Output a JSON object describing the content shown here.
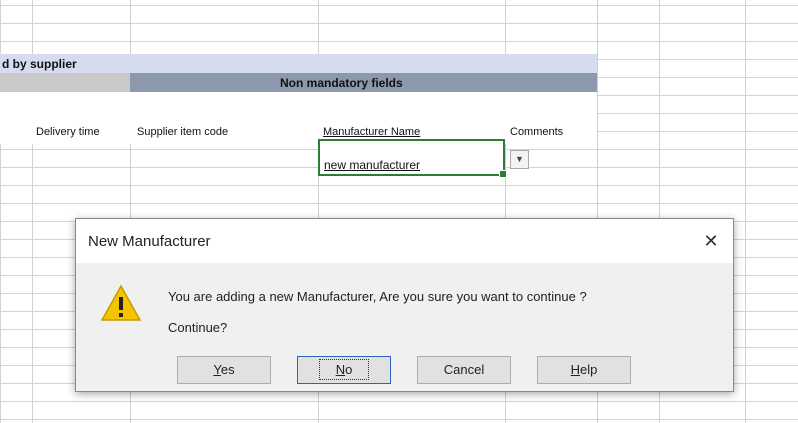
{
  "sheet": {
    "group_header": "d by supplier",
    "section_header": "Non mandatory fields",
    "columns": [
      "Delivery time",
      "Supplier item code",
      "Manufacturer Name",
      "Comments"
    ],
    "selected_cell_value": "new manufacturer"
  },
  "dialog": {
    "title": "New Manufacturer",
    "message": "You are adding a new Manufacturer, Are you sure you want to continue ?",
    "question": "Continue?",
    "buttons": {
      "yes": {
        "first": "Y",
        "rest": "es"
      },
      "no": {
        "first": "N",
        "rest": "o"
      },
      "cancel": "Cancel",
      "help": {
        "first": "H",
        "rest": "elp"
      }
    },
    "close_glyph": "✕",
    "icon": "warning-icon"
  },
  "colors": {
    "selection_border": "#2e7d32",
    "header_blue": "#d6dcf0",
    "header_dark": "#8c98ac",
    "warning_yellow": "#f5c400",
    "default_button_border": "#2a62bf"
  }
}
